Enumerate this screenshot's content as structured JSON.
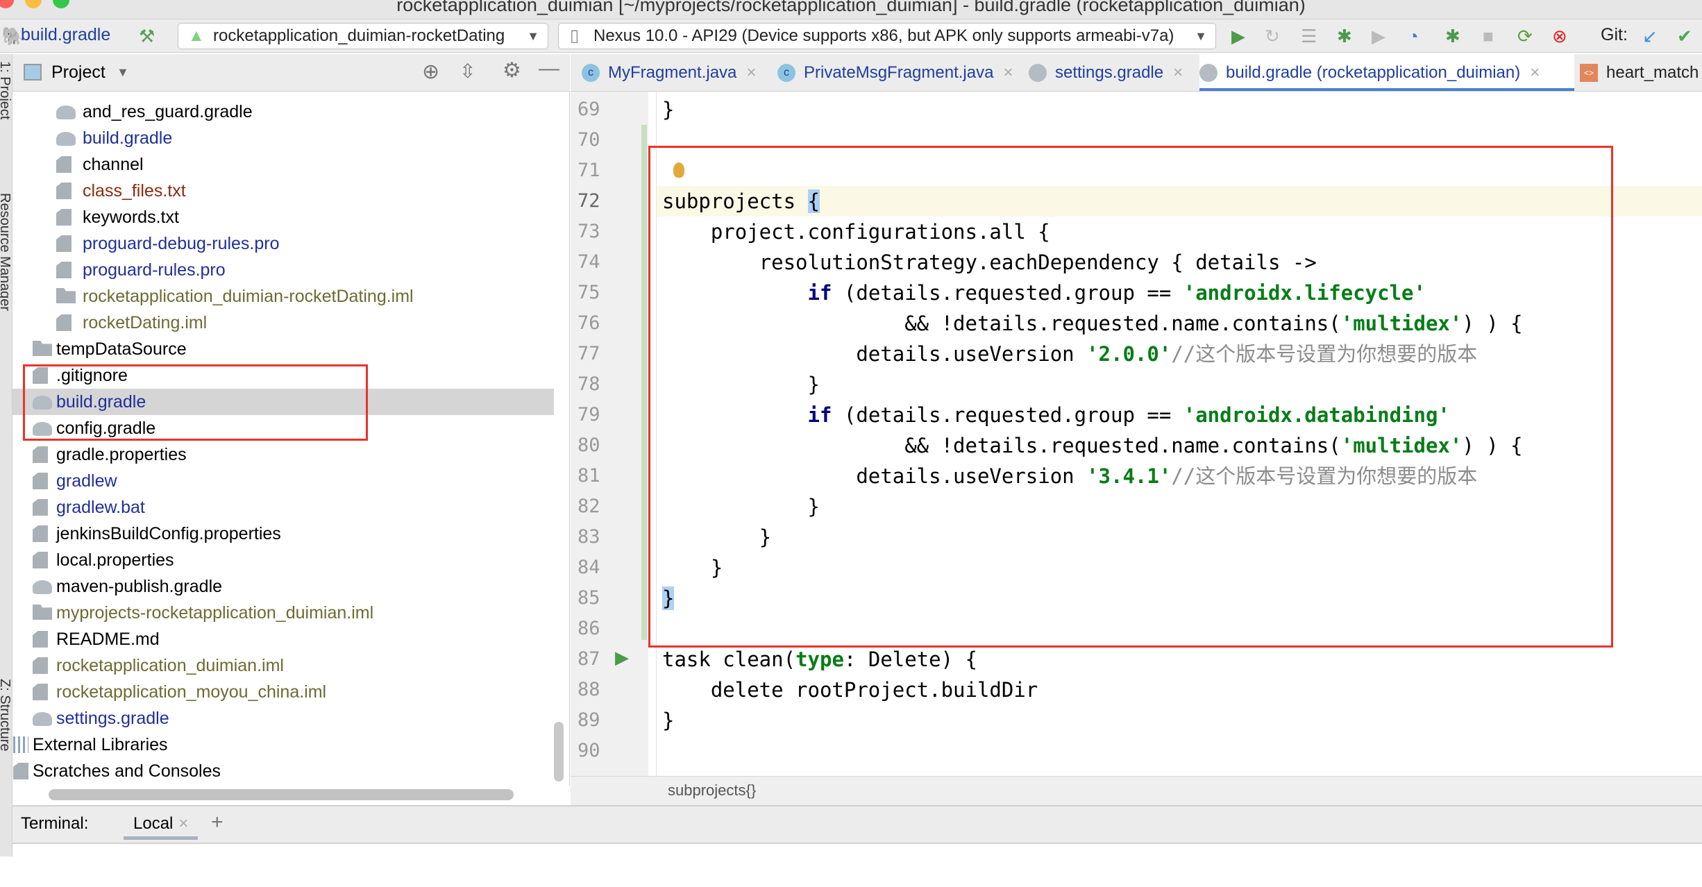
{
  "window": {
    "title": "rocketapplication_duimian [~/myprojects/rocketapplication_duimian] - build.gradle (rocketapplication_duimian)"
  },
  "toolbar": {
    "file_label": "build.gradle",
    "run_config": "rocketapplication_duimian-rocketDating",
    "device": "Nexus 10.0 - API29 (Device supports x86, but APK only supports armeabi-v7a)",
    "git_label": "Git:",
    "icons": [
      "hammer-icon",
      "run-icon",
      "apply-changes-icon",
      "apply-code-changes-icon",
      "debug-icon",
      "coverage-icon",
      "profiler-icon",
      "attach-debugger-icon",
      "stop-icon",
      "sync-icon",
      "sync-error-icon",
      "git-update-icon",
      "git-commit-icon"
    ]
  },
  "project_panel": {
    "title": "Project",
    "items": [
      {
        "label": "and_res_guard.gradle",
        "level": 2,
        "icon": "gradle",
        "color": "#000000"
      },
      {
        "label": "build.gradle",
        "level": 2,
        "icon": "gradle",
        "color": "#1f2f9a"
      },
      {
        "label": "channel",
        "level": 2,
        "icon": "file",
        "color": "#000000"
      },
      {
        "label": "class_files.txt",
        "level": 2,
        "icon": "file",
        "color": "#8a2b0e"
      },
      {
        "label": "keywords.txt",
        "level": 2,
        "icon": "file",
        "color": "#000000"
      },
      {
        "label": "proguard-debug-rules.pro",
        "level": 2,
        "icon": "file",
        "color": "#1f2f9a"
      },
      {
        "label": "proguard-rules.pro",
        "level": 2,
        "icon": "file",
        "color": "#1f2f9a"
      },
      {
        "label": "rocketapplication_duimian-rocketDating.iml",
        "level": 2,
        "icon": "folder",
        "color": "#6b6b33"
      },
      {
        "label": "rocketDating.iml",
        "level": 2,
        "icon": "file",
        "color": "#6b6b33"
      },
      {
        "label": "tempDataSource",
        "level": 1,
        "icon": "folder",
        "color": "#000000"
      },
      {
        "label": ".gitignore",
        "level": 1,
        "icon": "file",
        "color": "#000000"
      },
      {
        "label": "build.gradle",
        "level": 1,
        "icon": "gradle",
        "color": "#1f2f9a",
        "selected": true
      },
      {
        "label": "config.gradle",
        "level": 1,
        "icon": "gradle",
        "color": "#000000"
      },
      {
        "label": "gradle.properties",
        "level": 1,
        "icon": "file",
        "color": "#000000"
      },
      {
        "label": "gradlew",
        "level": 1,
        "icon": "file",
        "color": "#1f2f9a"
      },
      {
        "label": "gradlew.bat",
        "level": 1,
        "icon": "file",
        "color": "#1f2f9a"
      },
      {
        "label": "jenkinsBuildConfig.properties",
        "level": 1,
        "icon": "file",
        "color": "#000000"
      },
      {
        "label": "local.properties",
        "level": 1,
        "icon": "file",
        "color": "#000000"
      },
      {
        "label": "maven-publish.gradle",
        "level": 1,
        "icon": "gradle",
        "color": "#000000"
      },
      {
        "label": "myprojects-rocketapplication_duimian.iml",
        "level": 1,
        "icon": "folder",
        "color": "#6b6b33"
      },
      {
        "label": "README.md",
        "level": 1,
        "icon": "file",
        "color": "#000000"
      },
      {
        "label": "rocketapplication_duimian.iml",
        "level": 1,
        "icon": "file",
        "color": "#6b6b33"
      },
      {
        "label": "rocketapplication_moyou_china.iml",
        "level": 1,
        "icon": "file",
        "color": "#6b6b33"
      },
      {
        "label": "settings.gradle",
        "level": 1,
        "icon": "gradle",
        "color": "#1f2f9a"
      },
      {
        "label": "External Libraries",
        "level": 0,
        "icon": "lib",
        "color": "#000000"
      },
      {
        "label": "Scratches and Consoles",
        "level": 0,
        "icon": "scratch",
        "color": "#000000"
      }
    ]
  },
  "side_strip": [
    "1: Project",
    "Resource Manager",
    "Z: Structure"
  ],
  "editor_tabs": [
    {
      "label": "MyFragment.java",
      "icon": "java-class"
    },
    {
      "label": "PrivateMsgFragment.java",
      "icon": "java-class"
    },
    {
      "label": "settings.gradle",
      "icon": "gradle"
    },
    {
      "label": "build.gradle (rocketapplication_duimian)",
      "icon": "gradle",
      "active": true
    },
    {
      "label": "heart_match",
      "icon": "xml"
    }
  ],
  "editor": {
    "lines": [
      {
        "n": "69",
        "tokens": [
          [
            "p",
            "}"
          ]
        ]
      },
      {
        "n": "70",
        "tokens": []
      },
      {
        "n": "71",
        "tokens": []
      },
      {
        "n": "72",
        "tokens": [
          [
            "p",
            "subprojects "
          ],
          [
            "brm",
            "{"
          ]
        ]
      },
      {
        "n": "73",
        "tokens": [
          [
            "p",
            "    project.configurations.all {"
          ]
        ]
      },
      {
        "n": "74",
        "tokens": [
          [
            "p",
            "        resolutionStrategy.eachDependency { details ->"
          ]
        ]
      },
      {
        "n": "75",
        "tokens": [
          [
            "p",
            "            "
          ],
          [
            "kw",
            "if"
          ],
          [
            "p",
            " (details.requested.group == "
          ],
          [
            "str",
            "'androidx.lifecycle'"
          ]
        ]
      },
      {
        "n": "76",
        "tokens": [
          [
            "p",
            "                    && !details.requested.name.contains("
          ],
          [
            "str",
            "'multidex'"
          ],
          [
            "p",
            ") ) {"
          ]
        ]
      },
      {
        "n": "77",
        "tokens": [
          [
            "p",
            "                details.useVersion "
          ],
          [
            "str",
            "'2.0.0'"
          ],
          [
            "cm",
            "//这个版本号设置为你想要的版本"
          ]
        ]
      },
      {
        "n": "78",
        "tokens": [
          [
            "p",
            "            }"
          ]
        ]
      },
      {
        "n": "79",
        "tokens": [
          [
            "p",
            "            "
          ],
          [
            "kw",
            "if"
          ],
          [
            "p",
            " (details.requested.group == "
          ],
          [
            "str",
            "'androidx.databinding'"
          ]
        ]
      },
      {
        "n": "80",
        "tokens": [
          [
            "p",
            "                    && !details.requested.name.contains("
          ],
          [
            "str",
            "'multidex'"
          ],
          [
            "p",
            ") ) {"
          ]
        ]
      },
      {
        "n": "81",
        "tokens": [
          [
            "p",
            "                details.useVersion "
          ],
          [
            "str",
            "'3.4.1'"
          ],
          [
            "cm",
            "//这个版本号设置为你想要的版本"
          ]
        ]
      },
      {
        "n": "82",
        "tokens": [
          [
            "p",
            "            }"
          ]
        ]
      },
      {
        "n": "83",
        "tokens": [
          [
            "p",
            "        }"
          ]
        ]
      },
      {
        "n": "84",
        "tokens": [
          [
            "p",
            "    }"
          ]
        ]
      },
      {
        "n": "85",
        "tokens": [
          [
            "brm",
            "}"
          ]
        ]
      },
      {
        "n": "86",
        "tokens": []
      },
      {
        "n": "87",
        "tokens": [
          [
            "p",
            "task clean("
          ],
          [
            "nm",
            "type"
          ],
          [
            "p",
            ": Delete) {"
          ]
        ]
      },
      {
        "n": "88",
        "tokens": [
          [
            "p",
            "    delete rootProject.buildDir"
          ]
        ]
      },
      {
        "n": "89",
        "tokens": [
          [
            "p",
            "}"
          ]
        ]
      },
      {
        "n": "90",
        "tokens": []
      }
    ],
    "current_line": "72",
    "breadcrumb": "subprojects{}"
  },
  "terminal": {
    "label": "Terminal:",
    "tab": "Local",
    "add": "+"
  },
  "colors": {
    "highlight_box": "#e8342a",
    "keyword": "#000080",
    "string": "#067d17",
    "comment": "#8c8c8c",
    "active_tab": "#4a7fd1"
  }
}
